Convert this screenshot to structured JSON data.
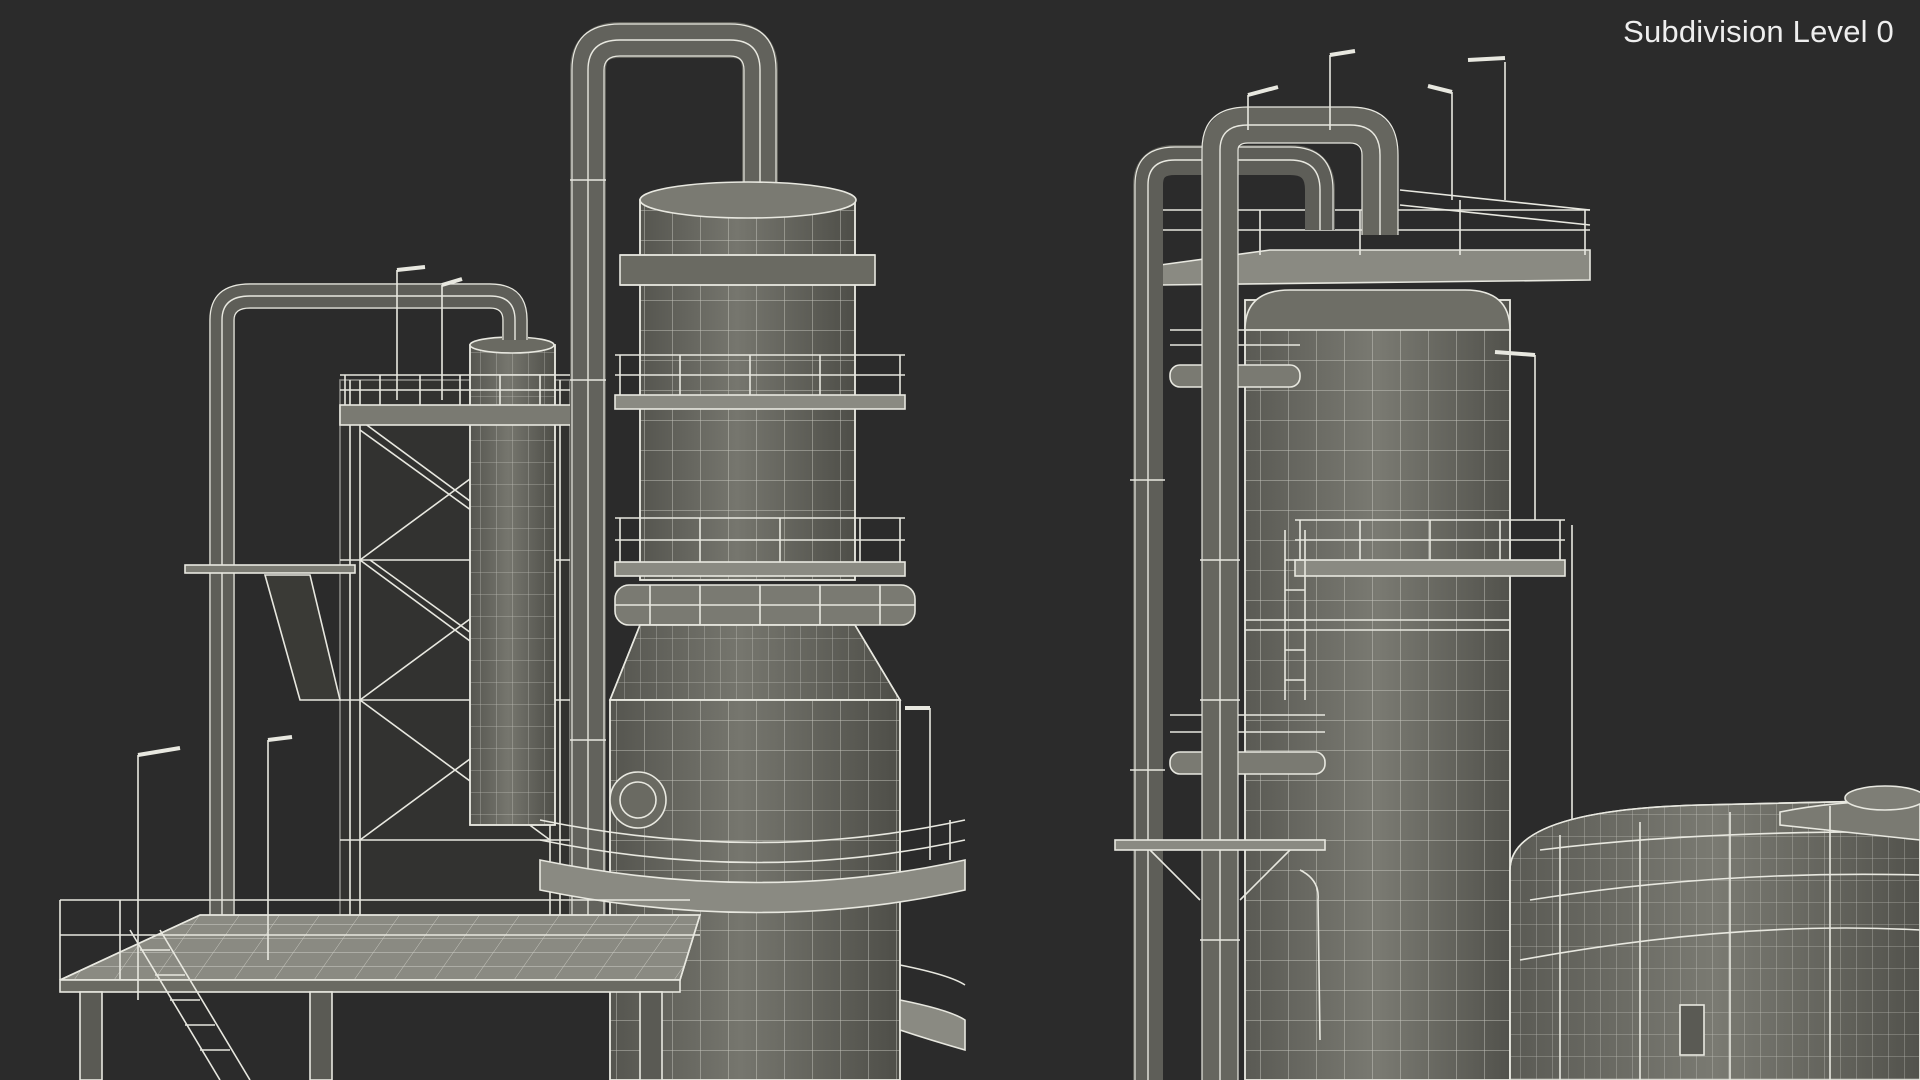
{
  "viewport": {
    "subdivision_label": "Subdivision Level 0"
  },
  "colors": {
    "background": "#2b2b2b",
    "model_fill": "#6e6e66",
    "model_fill_dark": "#55554f",
    "wire": "#e8e8e0",
    "label": "#eeeeee"
  },
  "scene": {
    "description_icon": "wireframe-industrial-refinery-model"
  }
}
